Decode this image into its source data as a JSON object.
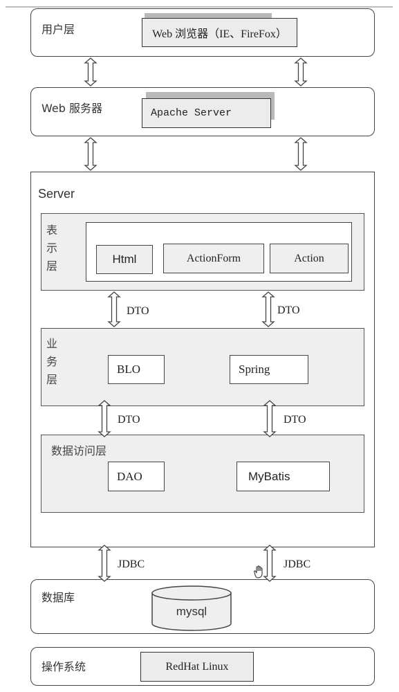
{
  "diagram": {
    "tiers": {
      "user": {
        "label": "用户层",
        "component": "Web 浏览器（IE、FireFox）"
      },
      "web_server": {
        "label": "Web 服务器",
        "component": "Apache Server"
      },
      "server": {
        "label": "Server",
        "presentation": {
          "label_chars": [
            "表",
            "示",
            "层"
          ],
          "components": [
            "Html",
            "ActionForm",
            "Action"
          ]
        },
        "business": {
          "label_chars": [
            "业",
            "务",
            "层"
          ],
          "components": [
            "BLO",
            "Spring"
          ]
        },
        "data_access": {
          "label": "数据访问层",
          "components": [
            "DAO",
            "MyBatis"
          ]
        }
      },
      "database": {
        "label": "数据库",
        "component": "mysql"
      },
      "os": {
        "label": "操作系统",
        "component": "RedHat Linux"
      }
    },
    "connectors": {
      "presentation_business": [
        "DTO",
        "DTO"
      ],
      "business_data_access": [
        "DTO",
        "DTO"
      ],
      "server_database": [
        "JDBC",
        "JDBC"
      ]
    },
    "icons": {
      "arrow": "double-headed-vertical-arrow",
      "cursor": "hand-cursor"
    }
  }
}
